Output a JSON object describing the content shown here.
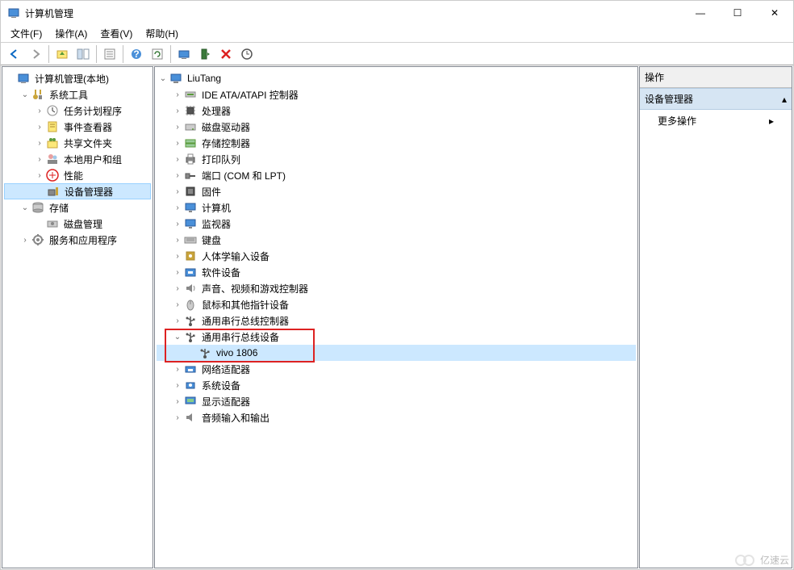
{
  "window": {
    "title": "计算机管理"
  },
  "winbtns": {
    "min": "—",
    "max": "☐",
    "close": "✕"
  },
  "menu": [
    {
      "label": "文件(F)"
    },
    {
      "label": "操作(A)"
    },
    {
      "label": "查看(V)"
    },
    {
      "label": "帮助(H)"
    }
  ],
  "leftTree": [
    {
      "depth": 0,
      "exp": "",
      "icon": "mmc",
      "label": "计算机管理(本地)"
    },
    {
      "depth": 1,
      "exp": "v",
      "icon": "tools",
      "label": "系统工具"
    },
    {
      "depth": 2,
      "exp": ">",
      "icon": "sched",
      "label": "任务计划程序"
    },
    {
      "depth": 2,
      "exp": ">",
      "icon": "event",
      "label": "事件查看器"
    },
    {
      "depth": 2,
      "exp": ">",
      "icon": "share",
      "label": "共享文件夹"
    },
    {
      "depth": 2,
      "exp": ">",
      "icon": "users",
      "label": "本地用户和组"
    },
    {
      "depth": 2,
      "exp": ">",
      "icon": "perf",
      "label": "性能"
    },
    {
      "depth": 2,
      "exp": "",
      "icon": "devmgr",
      "label": "设备管理器",
      "selected": true
    },
    {
      "depth": 1,
      "exp": "v",
      "icon": "storage",
      "label": "存储"
    },
    {
      "depth": 2,
      "exp": "",
      "icon": "disk",
      "label": "磁盘管理"
    },
    {
      "depth": 1,
      "exp": ">",
      "icon": "services",
      "label": "服务和应用程序"
    }
  ],
  "midTree": [
    {
      "depth": 0,
      "exp": "v",
      "icon": "pc",
      "label": "LiuTang"
    },
    {
      "depth": 1,
      "exp": ">",
      "icon": "ide",
      "label": "IDE ATA/ATAPI 控制器"
    },
    {
      "depth": 1,
      "exp": ">",
      "icon": "cpu",
      "label": "处理器"
    },
    {
      "depth": 1,
      "exp": ">",
      "icon": "hdd",
      "label": "磁盘驱动器"
    },
    {
      "depth": 1,
      "exp": ">",
      "icon": "stor",
      "label": "存储控制器"
    },
    {
      "depth": 1,
      "exp": ">",
      "icon": "print",
      "label": "打印队列"
    },
    {
      "depth": 1,
      "exp": ">",
      "icon": "port",
      "label": "端口 (COM 和 LPT)"
    },
    {
      "depth": 1,
      "exp": ">",
      "icon": "fw",
      "label": "固件"
    },
    {
      "depth": 1,
      "exp": ">",
      "icon": "monitor",
      "label": "计算机"
    },
    {
      "depth": 1,
      "exp": ">",
      "icon": "monitor",
      "label": "监视器"
    },
    {
      "depth": 1,
      "exp": ">",
      "icon": "kbd",
      "label": "键盘"
    },
    {
      "depth": 1,
      "exp": ">",
      "icon": "hid",
      "label": "人体学输入设备"
    },
    {
      "depth": 1,
      "exp": ">",
      "icon": "soft",
      "label": "软件设备"
    },
    {
      "depth": 1,
      "exp": ">",
      "icon": "sound",
      "label": "声音、视频和游戏控制器"
    },
    {
      "depth": 1,
      "exp": ">",
      "icon": "mouse",
      "label": "鼠标和其他指针设备"
    },
    {
      "depth": 1,
      "exp": ">",
      "icon": "usb",
      "label": "通用串行总线控制器"
    },
    {
      "depth": 1,
      "exp": "v",
      "icon": "usb",
      "label": "通用串行总线设备",
      "hl": true
    },
    {
      "depth": 2,
      "exp": "",
      "icon": "usb",
      "label": "vivo 1806",
      "hl": true,
      "sel": true
    },
    {
      "depth": 1,
      "exp": ">",
      "icon": "net",
      "label": "网络适配器"
    },
    {
      "depth": 1,
      "exp": ">",
      "icon": "sys",
      "label": "系统设备"
    },
    {
      "depth": 1,
      "exp": ">",
      "icon": "disp",
      "label": "显示适配器"
    },
    {
      "depth": 1,
      "exp": ">",
      "icon": "audio",
      "label": "音频输入和输出"
    }
  ],
  "actions": {
    "head": "操作",
    "cat": "设备管理器",
    "more": "更多操作"
  },
  "watermark": "亿速云"
}
